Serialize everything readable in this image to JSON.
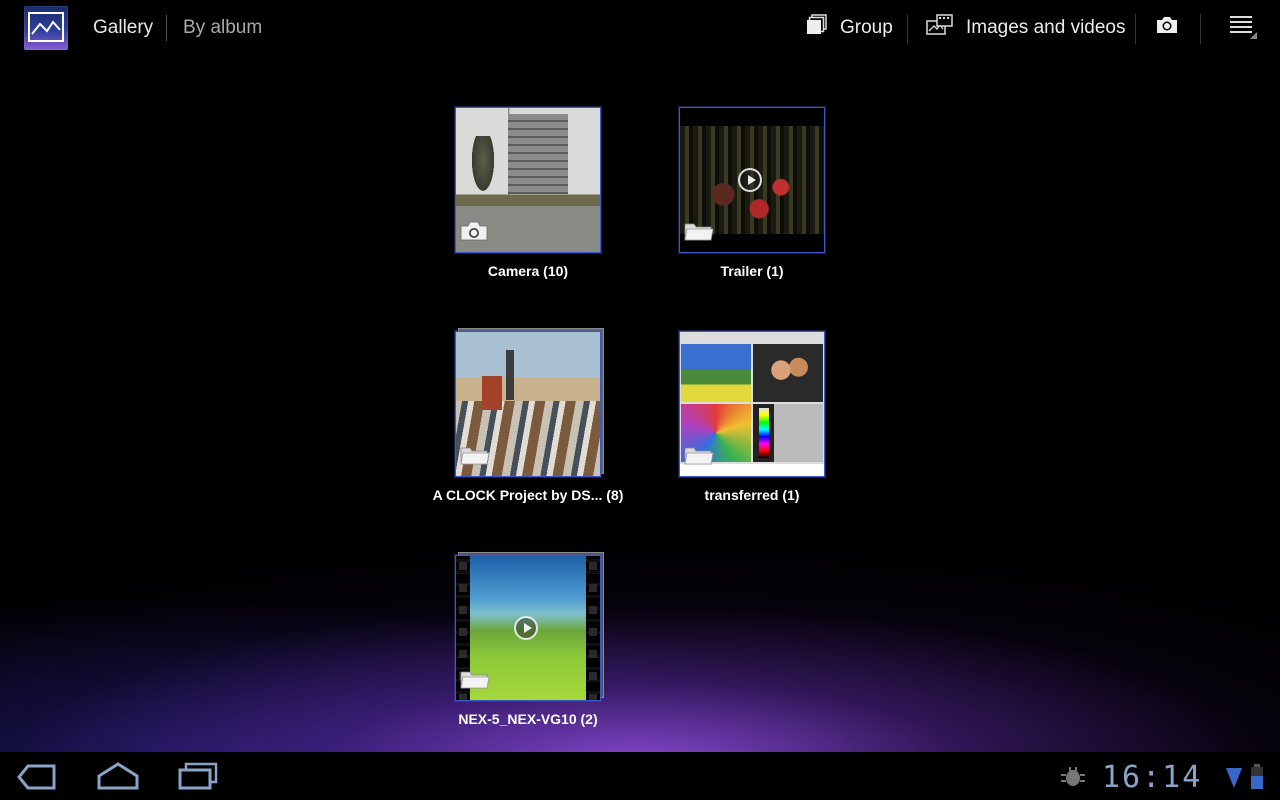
{
  "action_bar": {
    "title": "Gallery",
    "subtitle": "By album",
    "group_label": "Group",
    "filter_label": "Images and videos",
    "icons": {
      "app": "gallery-app-icon",
      "group": "group-icon",
      "filter": "images-videos-icon",
      "camera": "camera-icon",
      "menu": "overflow-menu-icon"
    }
  },
  "albums": [
    {
      "label": "Camera (10)",
      "badge": "camera-icon",
      "video": false
    },
    {
      "label": "Trailer (1)",
      "badge": "folder-icon",
      "video": true
    },
    {
      "label": "A CLOCK Project by DS... (8)",
      "badge": "folder-icon",
      "video": false
    },
    {
      "label": "transferred (1)",
      "badge": "folder-icon",
      "video": false
    },
    {
      "label": "NEX-5_NEX-VG10 (2)",
      "badge": "folder-icon",
      "video": true
    }
  ],
  "system_bar": {
    "time": "16:14",
    "icons": [
      "back-icon",
      "home-icon",
      "recent-apps-icon",
      "debug-icon",
      "wifi-icon",
      "battery-icon"
    ]
  },
  "colors": {
    "accent": "#3a58c8",
    "clock": "#8aa4c8"
  }
}
